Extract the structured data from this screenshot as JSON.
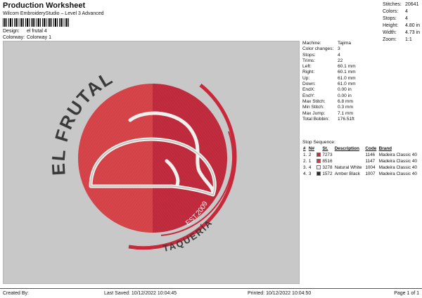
{
  "header": {
    "title": "Production Worksheet",
    "subtitle": "Wilcom EmbroideryStudio – Level 3 Advanced",
    "design_label": "Design:",
    "design_value": "el frutal 4",
    "colorway_label": "Colorway:",
    "colorway_value": "Colorway 1"
  },
  "stats": [
    {
      "label": "Stitches:",
      "value": "20641"
    },
    {
      "label": "Colors:",
      "value": "4"
    },
    {
      "label": "Stops:",
      "value": "4"
    },
    {
      "label": "Height:",
      "value": "4.80 in"
    },
    {
      "label": "Width:",
      "value": "4.73 in"
    },
    {
      "label": "Zoom:",
      "value": "1:1"
    }
  ],
  "machine_info": [
    {
      "label": "Machine:",
      "value": "Tajima"
    },
    {
      "label": "Color changes:",
      "value": "3"
    },
    {
      "label": "Stops:",
      "value": "4"
    },
    {
      "label": "Trims:",
      "value": "22"
    },
    {
      "label": "Left:",
      "value": "60.1 mm"
    },
    {
      "label": "Right:",
      "value": "60.1 mm"
    },
    {
      "label": "Up:",
      "value": "61.0 mm"
    },
    {
      "label": "Down:",
      "value": "61.0 mm"
    },
    {
      "label": "EndX:",
      "value": "0.00 in"
    },
    {
      "label": "EndY:",
      "value": "0.00 in"
    },
    {
      "label": "Max Stitch:",
      "value": "6.8 mm"
    },
    {
      "label": "Min Stitch:",
      "value": "0.3 mm"
    },
    {
      "label": "Max Jump:",
      "value": "7.1 mm"
    },
    {
      "label": "Total Bobbin:",
      "value": "176.51ft"
    }
  ],
  "stop_sequence": {
    "title": "Stop Sequence:",
    "headers": [
      "#",
      "N#",
      "",
      "St.",
      "Description",
      "Code",
      "Brand"
    ],
    "rows": [
      {
        "num": "1.",
        "n": "2",
        "color": "#c8293a",
        "st": "7273",
        "desc": "",
        "code": "1146",
        "brand": "Madeira Classic 40"
      },
      {
        "num": "2.",
        "n": "1",
        "color": "#d23a44",
        "st": "8516",
        "desc": "",
        "code": "1147",
        "brand": "Madeira Classic 40"
      },
      {
        "num": "3.",
        "n": "4",
        "color": "#f2f2f2",
        "st": "3278",
        "desc": "Natural White",
        "code": "1004",
        "brand": "Madeira Classic 40"
      },
      {
        "num": "4.",
        "n": "3",
        "color": "#262626",
        "st": "1572",
        "desc": "Amber Black",
        "code": "1007",
        "brand": "Madeira Classic 40"
      }
    ]
  },
  "logo": {
    "top_text": "EL FRUTAL",
    "bottom_text": "TAQUERÍA",
    "est_text": "EST.2009"
  },
  "colors": {
    "left_half": "#d6454a",
    "right_half": "#c22c3f",
    "ring": "#c8293a",
    "text_dark": "#3a3a3a",
    "taco_outline": "#f0f0ec"
  },
  "footer": {
    "created_by": "Created By:",
    "last_saved": "Last Saved: 10/12/2022 10:04:45",
    "printed": "Printed: 10/12/2022 10:04:50",
    "page": "Page 1 of 1"
  }
}
